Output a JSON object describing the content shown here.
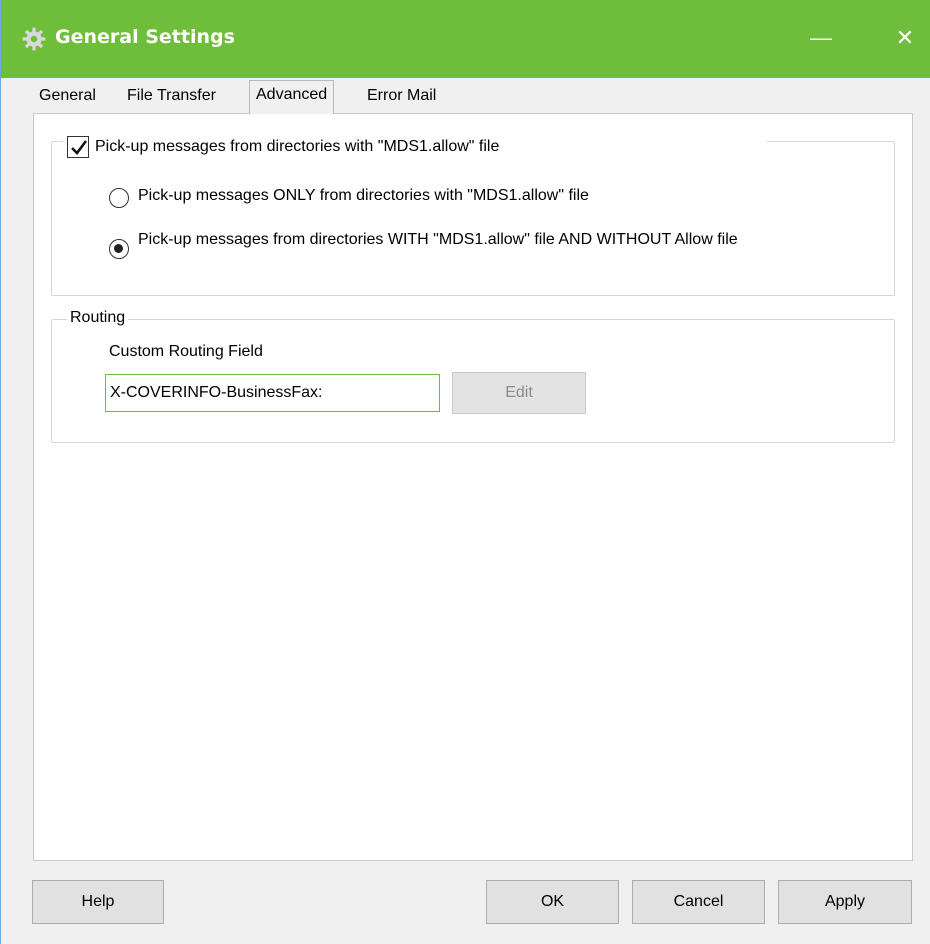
{
  "window": {
    "title": "General Settings",
    "minimize_glyph": "—",
    "close_glyph": "✕",
    "title_icon": "gear-icon"
  },
  "tabs": [
    {
      "label": "General",
      "active": false
    },
    {
      "label": "File Transfer",
      "active": false
    },
    {
      "label": "Advanced",
      "active": true
    },
    {
      "label": "Error Mail",
      "active": false
    }
  ],
  "pickup": {
    "checkbox_label": "Pick-up messages from directories with \"MDS1.allow\" file",
    "checkbox_checked": true,
    "options": [
      {
        "label": "Pick-up messages ONLY from directories with \"MDS1.allow\" file",
        "checked": false
      },
      {
        "label": "Pick-up messages from directories WITH \"MDS1.allow\" file AND WITHOUT Allow file",
        "checked": true
      }
    ]
  },
  "routing": {
    "group_label": "Routing",
    "field_label": "Custom Routing Field",
    "field_value": "X-COVERINFO-BusinessFax:",
    "edit_label": "Edit"
  },
  "buttons": {
    "help": "Help",
    "ok": "OK",
    "cancel": "Cancel",
    "apply": "Apply"
  },
  "colors": {
    "titlebar": "#6ebe3b",
    "input_focus_border": "#6ebe3b"
  }
}
